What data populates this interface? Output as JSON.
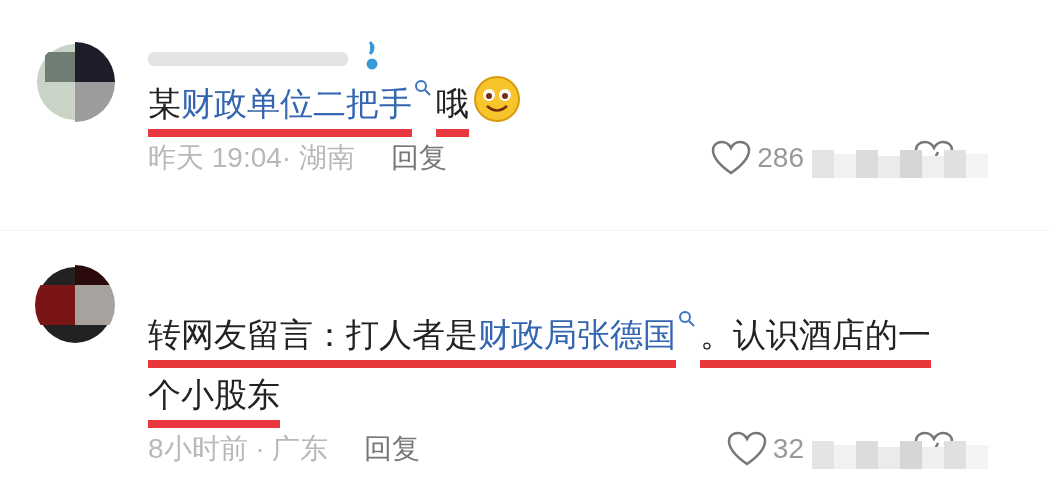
{
  "comments": [
    {
      "segments": [
        {
          "kind": "text",
          "text": "某"
        },
        {
          "kind": "link",
          "text": "财政单位二把手"
        },
        {
          "kind": "text",
          "text": "哦"
        },
        {
          "kind": "emoji"
        }
      ],
      "underlined": true,
      "time_location": "昨天 19:04· 湖南",
      "reply": "回复",
      "likes": "286"
    },
    {
      "segments": [
        {
          "kind": "text",
          "text": "转网友留言：打人者是"
        },
        {
          "kind": "link",
          "text": "财政局张德国"
        },
        {
          "kind": "text",
          "text": "。认识酒店的一个小股东"
        }
      ],
      "underlined": true,
      "time_location": "8小时前 · 广东",
      "reply": "回复",
      "likes": "32"
    }
  ]
}
